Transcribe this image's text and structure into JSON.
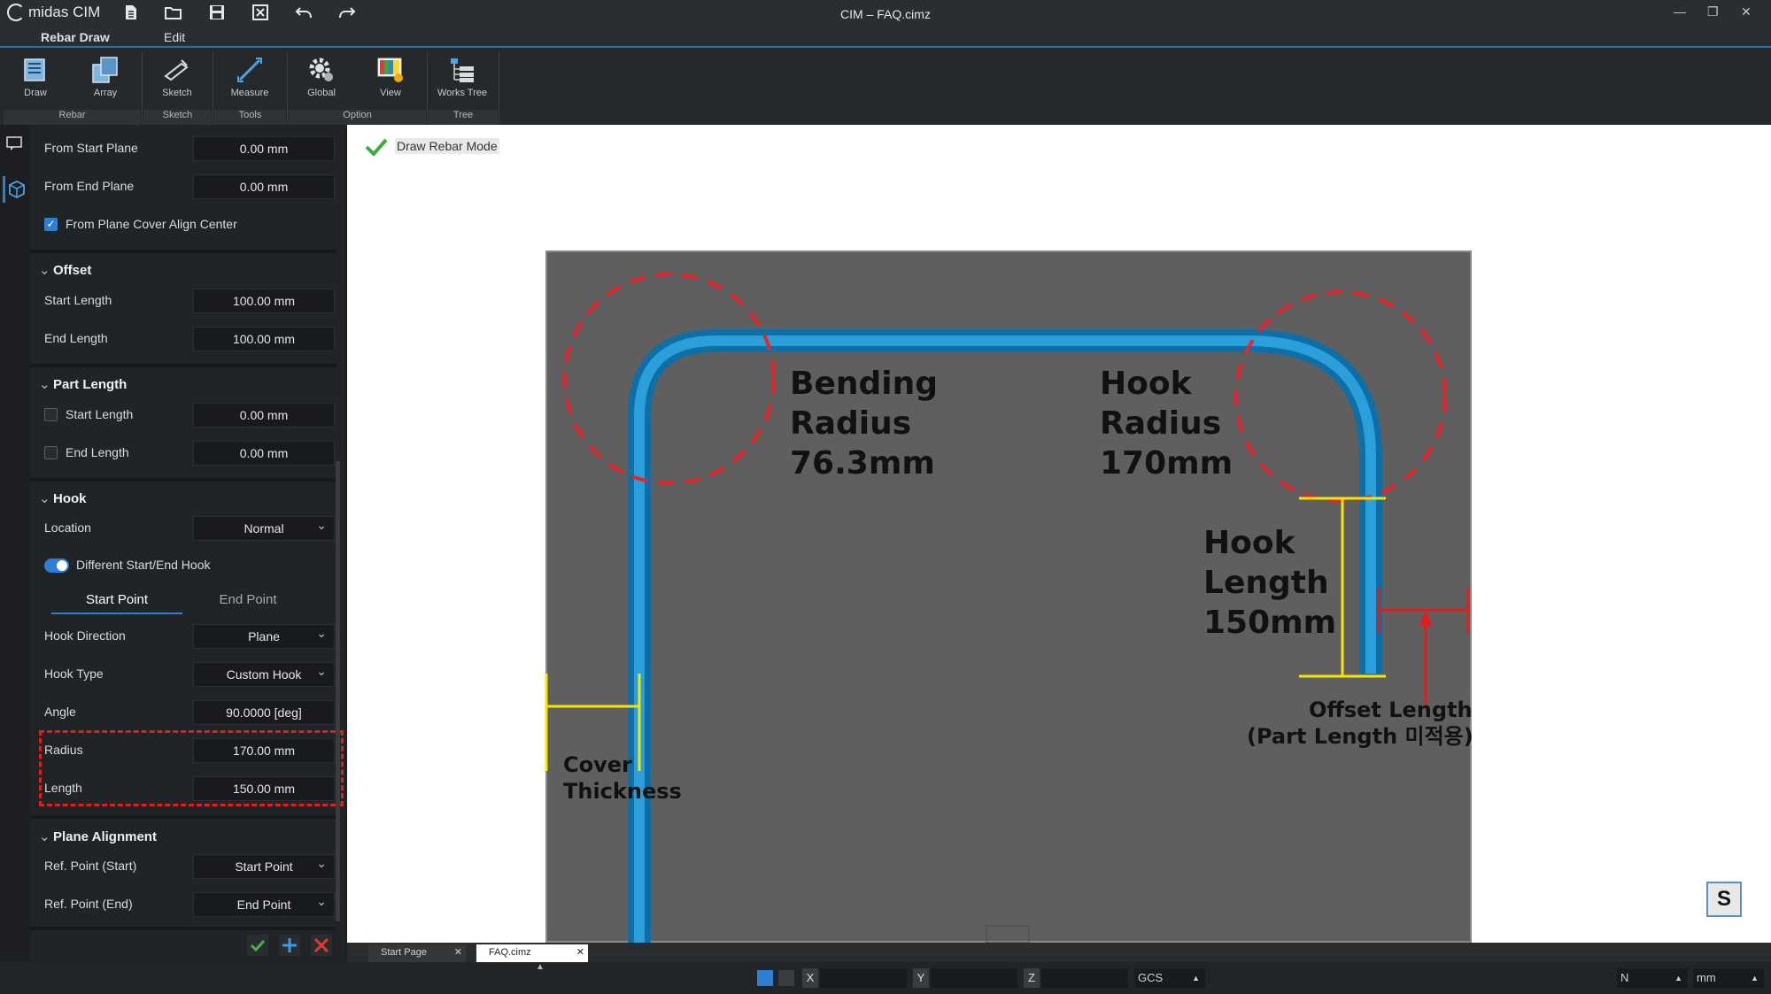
{
  "app": {
    "logo_text": "midas CIM",
    "window_title": "CIM – FAQ.cimz"
  },
  "menu": {
    "tabs": [
      "Rebar Draw",
      "Edit"
    ]
  },
  "ribbon": {
    "buttons": {
      "draw": "Draw",
      "array": "Array",
      "sketch": "Sketch",
      "measure": "Measure",
      "global": "Global",
      "view": "View",
      "works_tree": "Works Tree"
    },
    "groups": {
      "rebar": "Rebar",
      "sketch": "Sketch",
      "tools": "Tools",
      "option": "Option",
      "tree": "Tree"
    }
  },
  "panel": {
    "from_start_plane": {
      "label": "From Start Plane",
      "value": "0.00 mm"
    },
    "from_end_plane": {
      "label": "From End Plane",
      "value": "0.00 mm"
    },
    "align_center": {
      "label": "From Plane Cover Align Center",
      "checked": true
    },
    "offset": {
      "title": "Offset",
      "start_length": {
        "label": "Start Length",
        "value": "100.00 mm"
      },
      "end_length": {
        "label": "End Length",
        "value": "100.00 mm"
      }
    },
    "part_length": {
      "title": "Part Length",
      "start_length": {
        "label": "Start Length",
        "value": "0.00 mm",
        "checked": false
      },
      "end_length": {
        "label": "End Length",
        "value": "0.00 mm",
        "checked": false
      }
    },
    "hook": {
      "title": "Hook",
      "location": {
        "label": "Location",
        "value": "Normal"
      },
      "different_toggle": {
        "label": "Different Start/End Hook",
        "on": true
      },
      "subtabs": {
        "start": "Start Point",
        "end": "End Point"
      },
      "hook_direction": {
        "label": "Hook Direction",
        "value": "Plane"
      },
      "hook_type": {
        "label": "Hook Type",
        "value": "Custom Hook"
      },
      "angle": {
        "label": "Angle",
        "value": "90.0000 [deg]"
      },
      "radius": {
        "label": "Radius",
        "value": "170.00 mm"
      },
      "length": {
        "label": "Length",
        "value": "150.00 mm"
      }
    },
    "plane_alignment": {
      "title": "Plane Alignment",
      "ref_start": {
        "label": "Ref. Point (Start)",
        "value": "Start Point"
      },
      "ref_end": {
        "label": "Ref. Point (End)",
        "value": "End Point"
      }
    }
  },
  "canvas": {
    "mode_label": "Draw Rebar Mode",
    "annotations": {
      "bending": [
        "Bending",
        "Radius",
        "76.3mm"
      ],
      "hook_radius": [
        "Hook",
        "Radius",
        "170mm"
      ],
      "hook_length": [
        "Hook",
        "Length",
        "150mm"
      ],
      "offset": [
        "Offset Length",
        "(Part Length 미적용)"
      ],
      "cover": [
        "Cover",
        "Thickness"
      ]
    },
    "nav_badge": "S"
  },
  "doc_tabs": [
    "Start Page",
    "FAQ.cimz"
  ],
  "status": {
    "x_label": "X",
    "y_label": "Y",
    "z_label": "Z",
    "coord_system": "GCS",
    "force_unit": "N",
    "length_unit": "mm"
  }
}
